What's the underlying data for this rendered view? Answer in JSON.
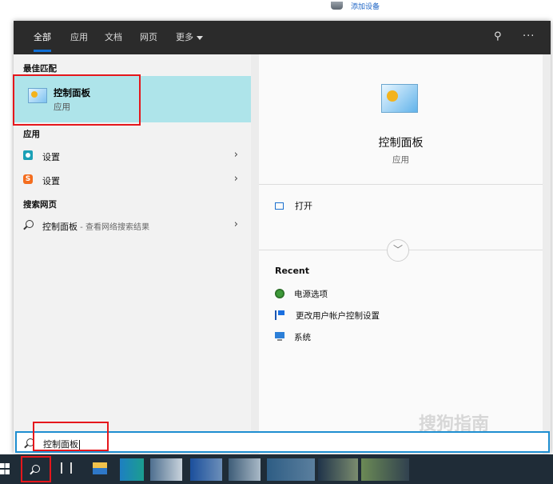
{
  "top": {
    "add_device_label": "添加设备"
  },
  "tabs": [
    "全部",
    "应用",
    "文档",
    "网页",
    "更多"
  ],
  "sections": {
    "best_match": "最佳匹配",
    "apps": "应用",
    "web": "搜索网页"
  },
  "best_match": {
    "title": "控制面板",
    "subtitle": "应用"
  },
  "app_results": [
    {
      "label": "设置",
      "icon": "settings-gear-icon"
    },
    {
      "label": "设置",
      "icon": "sogou-s-icon"
    }
  ],
  "web_result": {
    "label": "控制面板",
    "suffix": " - 查看网络搜索结果"
  },
  "detail": {
    "title": "控制面板",
    "subtitle": "应用",
    "open_label": "打开",
    "recent_heading": "Recent",
    "recent": [
      "电源选项",
      "更改用户帐户控制设置",
      "系统"
    ]
  },
  "search": {
    "query": "控制面板"
  },
  "watermark": "搜狗指南",
  "colors": {
    "accent": "#0f6fd6",
    "selected_bg": "#aee4ea",
    "highlight_box": "#e5171c",
    "tabbar_bg": "#2b2b2b"
  }
}
